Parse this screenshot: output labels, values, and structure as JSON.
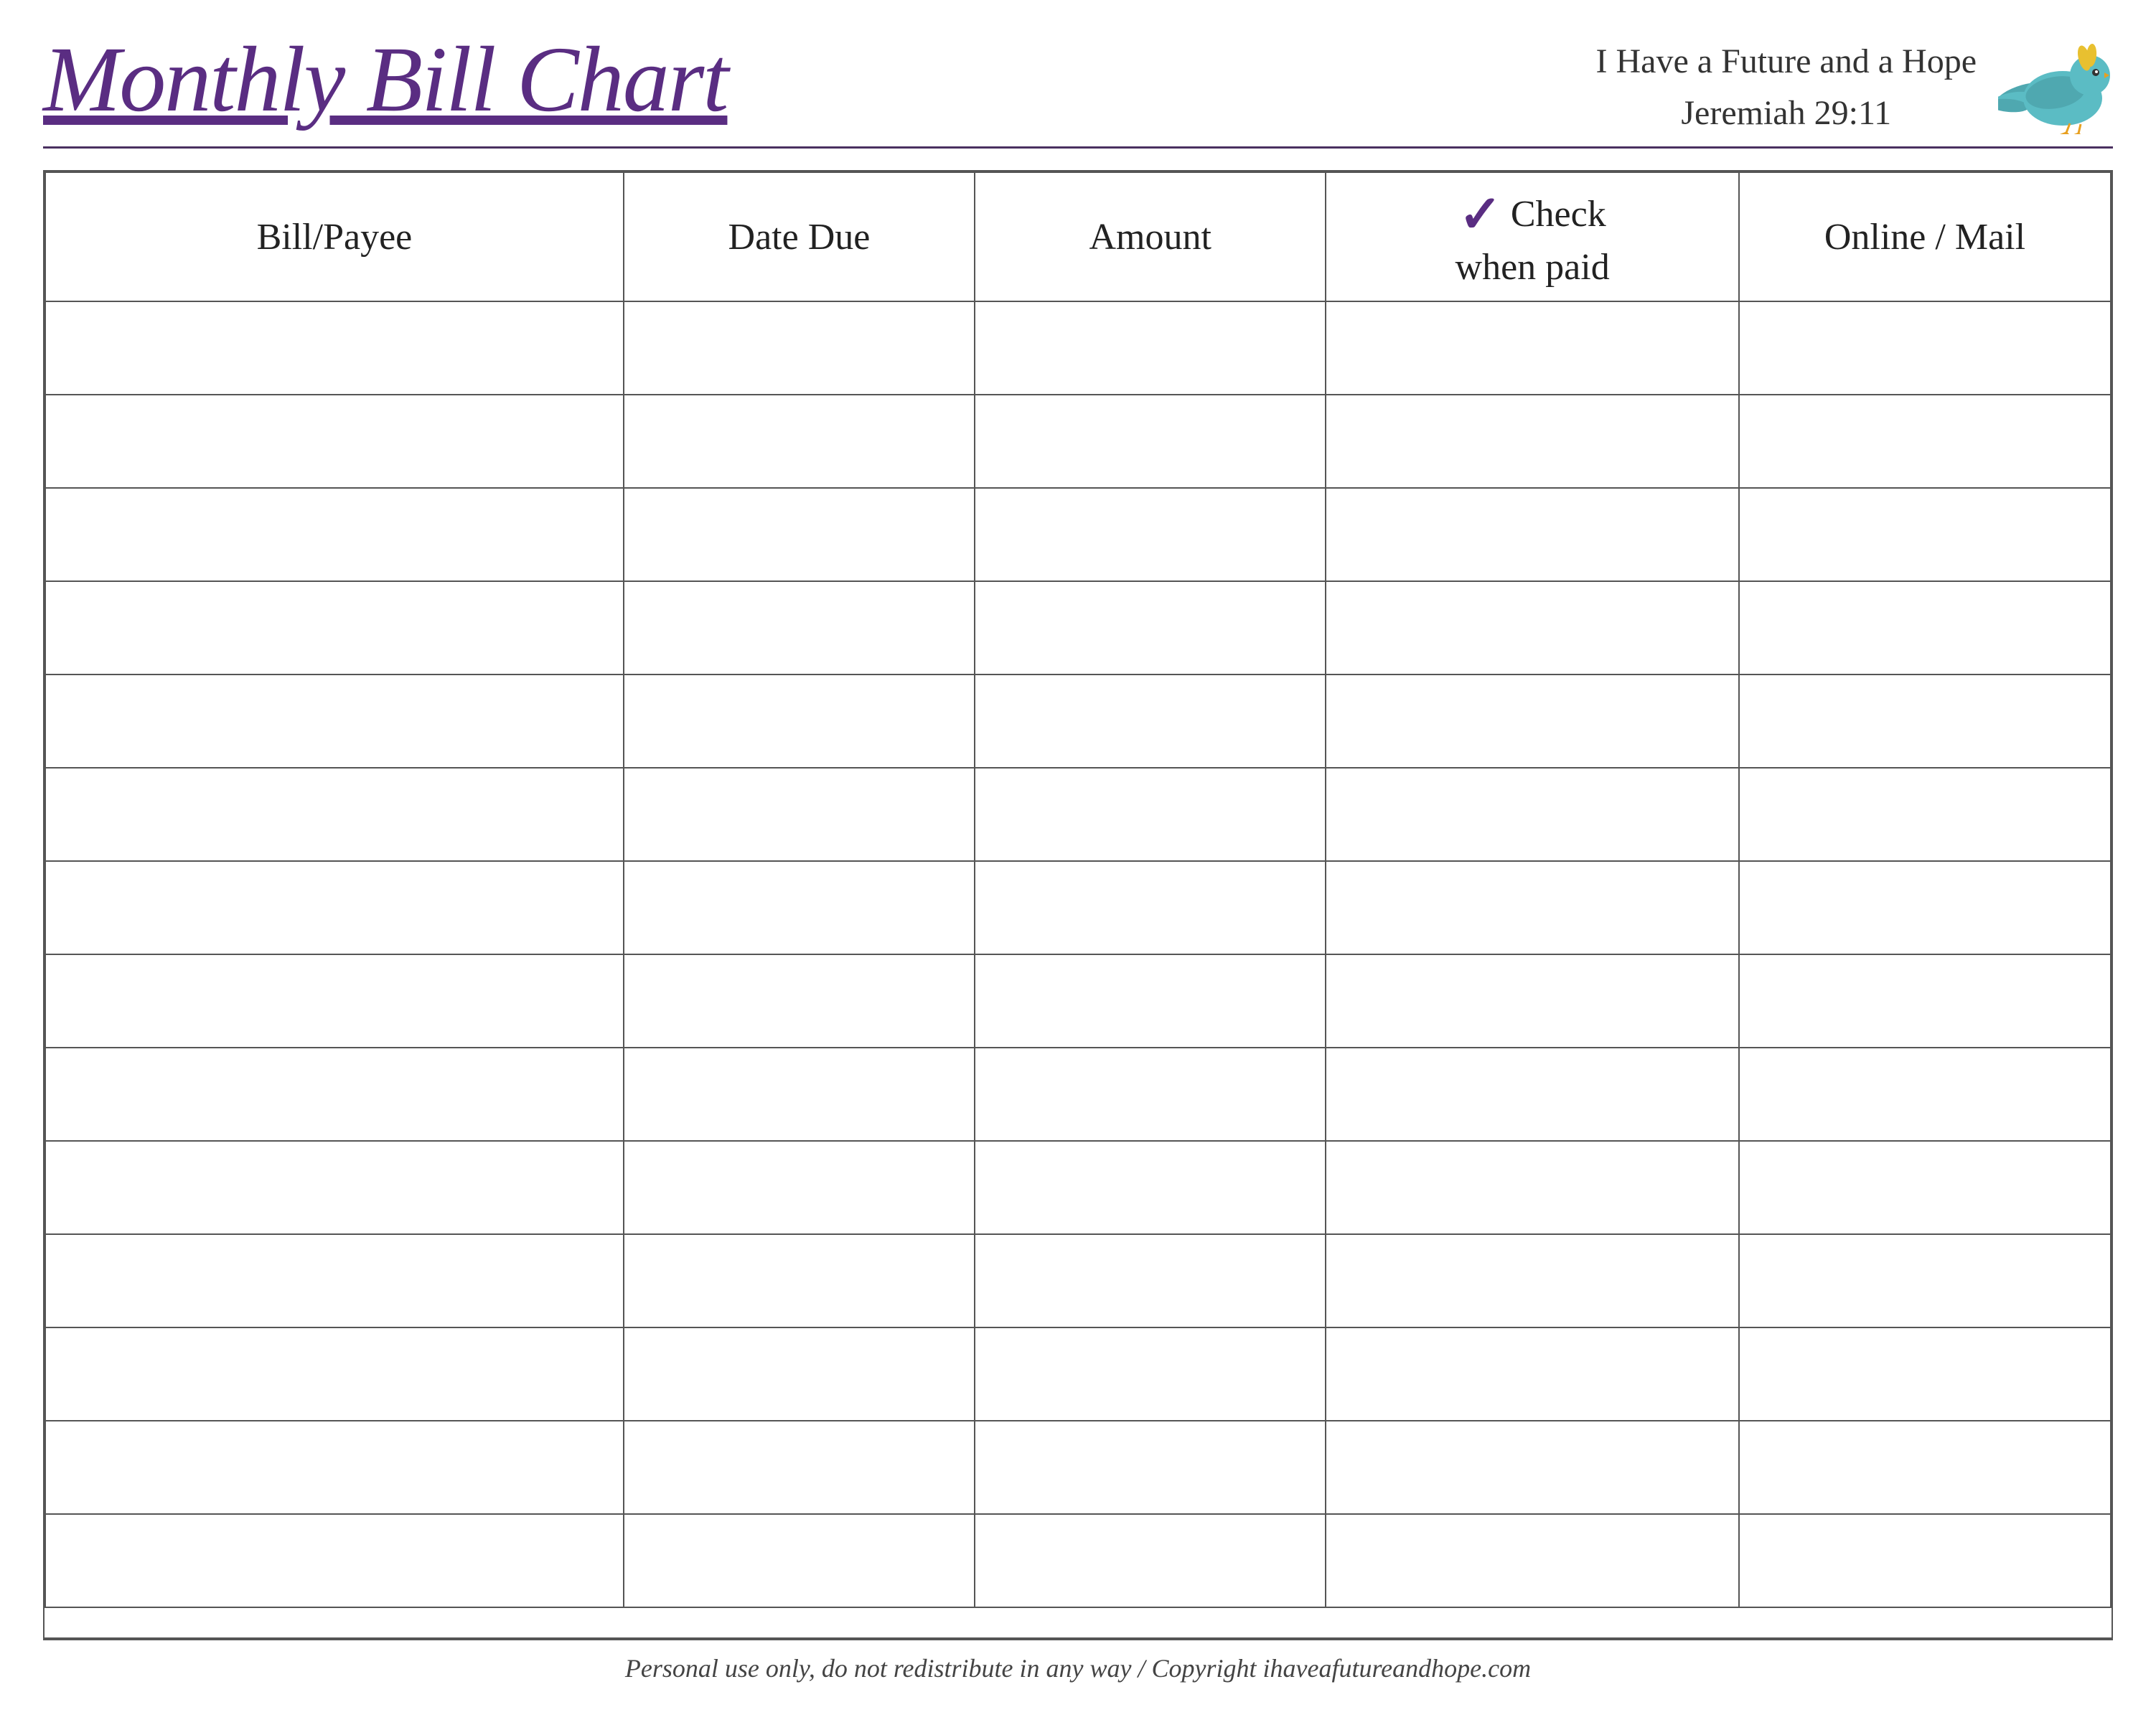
{
  "header": {
    "title": "Monthly Bill Chart",
    "scripture_line1": "I Have a Future and a Hope",
    "scripture_line2": "Jeremiah 29:11"
  },
  "columns": {
    "bill_payee": "Bill/Payee",
    "date_due": "Date Due",
    "amount": "Amount",
    "check_when_paid": "Check",
    "check_sub": "when paid",
    "online_mail": "Online / Mail"
  },
  "rows": 14,
  "footer": "Personal use only, do not redistribute in any way / Copyright ihaveafutureandhope.com"
}
